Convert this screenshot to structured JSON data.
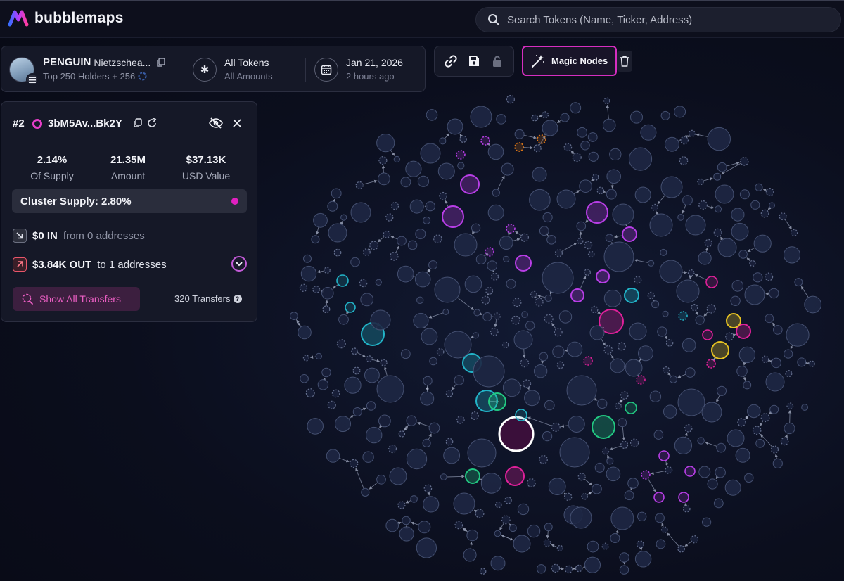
{
  "app": {
    "name": "bubblemaps"
  },
  "search": {
    "placeholder": "Search Tokens (Name, Ticker, Address)"
  },
  "token": {
    "ticker": "PENGUIN",
    "name": "Nietzschea...",
    "holders_label": "Top 250 Holders + 256",
    "chain_icon": "solana-icon"
  },
  "filters": {
    "tokens_label": "All Tokens",
    "amounts_label": "All Amounts",
    "date_label": "Jan 21, 2026",
    "time_ago": "2 hours ago"
  },
  "toolbar": {
    "items": [
      "link-icon",
      "save-icon",
      "lock-icon"
    ],
    "magic_label": "Magic Nodes"
  },
  "wallet": {
    "rank": "#2",
    "address": "3bM5Av...Bk2Y",
    "stats": [
      {
        "value": "2.14%",
        "label": "Of Supply"
      },
      {
        "value": "21.35M",
        "label": "Amount"
      },
      {
        "value": "$37.13K",
        "label": "USD Value"
      }
    ],
    "cluster_supply": "Cluster Supply: 2.80%",
    "in_amount": "$0 IN",
    "in_desc": "from 0 addresses",
    "out_amount": "$3.84K OUT",
    "out_desc": "to 1 addresses",
    "show_all_label": "Show All Transfers",
    "transfers_count": "320 Transfers"
  },
  "colors": {
    "accent": "#e020c0",
    "bubble_default": "#232c48",
    "purple": "#b83ee6",
    "magenta": "#e0209a",
    "teal": "#22b4c8",
    "green": "#22c882",
    "yellow": "#e6c222",
    "orange": "#e07818"
  }
}
